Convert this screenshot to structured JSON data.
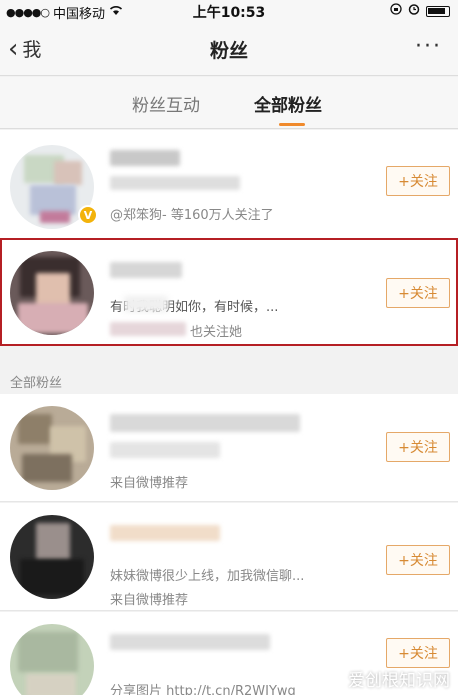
{
  "status": {
    "carrier": "中国移动",
    "time": "上午10:53"
  },
  "nav": {
    "back_label": "我",
    "title": "粉丝",
    "more": "···"
  },
  "tabs": [
    {
      "label": "粉丝互动"
    },
    {
      "label": "全部粉丝"
    }
  ],
  "follow_label": "+关注",
  "section_label": "全部粉丝",
  "rows": [
    {
      "subtitle": "@郑笨狗- 等160万人关注了"
    },
    {
      "message": "有时我聪明如你，有时候，...",
      "also_follows": "也关注她"
    },
    {
      "subtitle": "来自微博推荐"
    },
    {
      "message": "妹妹微博很少上线，加我微信聊...",
      "subtitle": "来自微博推荐"
    },
    {
      "subtitle": "分享图片 http://t.cn/R2WJYwg"
    }
  ],
  "watermark": "爱创根知识网",
  "colors": {
    "accent": "#f08a2c",
    "follow_border": "#e5a868",
    "highlight": "#b51f24"
  }
}
